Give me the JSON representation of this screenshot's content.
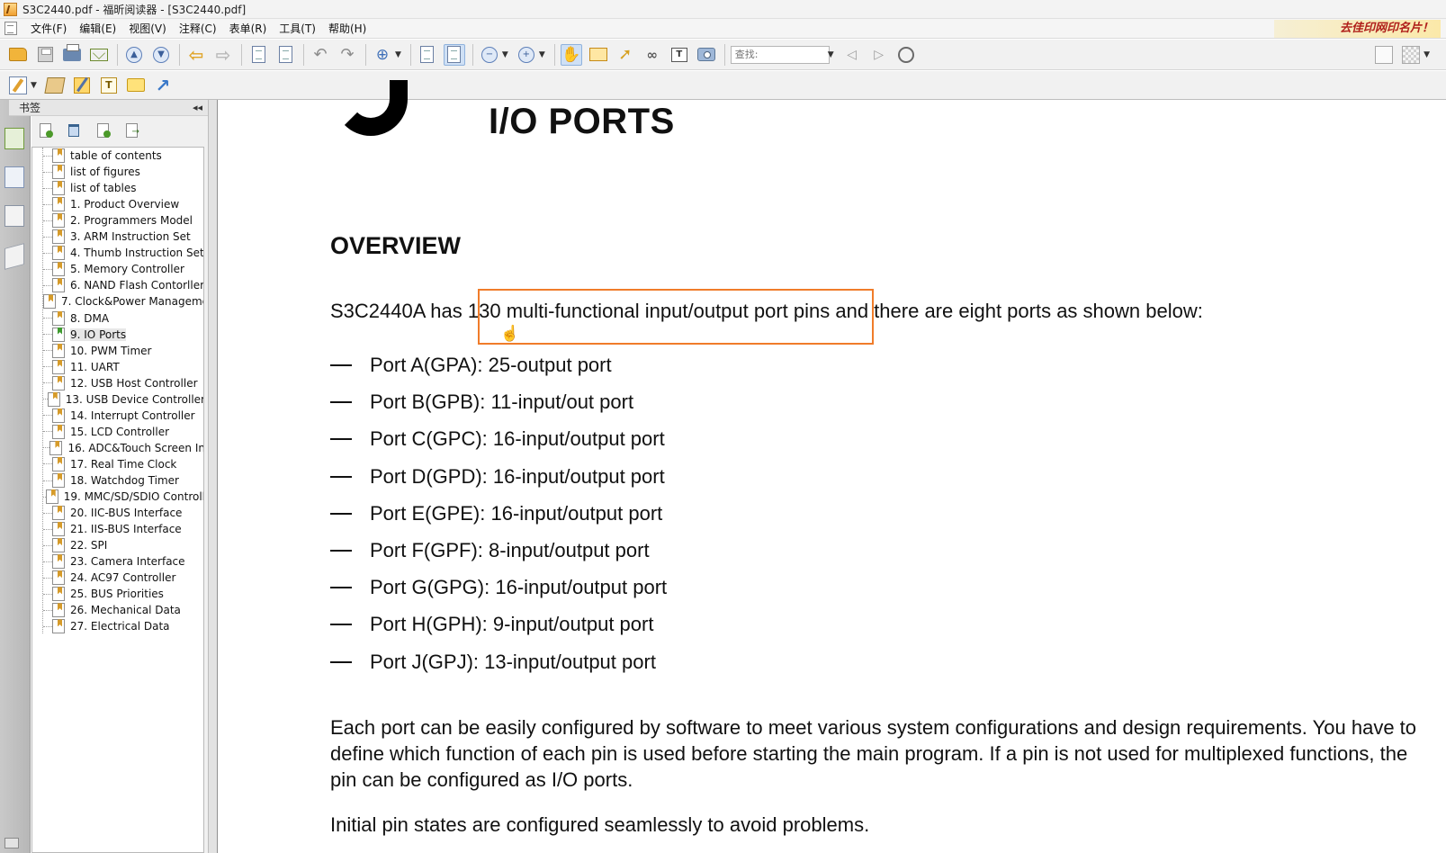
{
  "window": {
    "title": "S3C2440.pdf - 福昕阅读器 - [S3C2440.pdf]"
  },
  "menu": {
    "items": [
      "文件(F)",
      "编辑(E)",
      "视图(V)",
      "注释(C)",
      "表单(R)",
      "工具(T)",
      "帮助(H)"
    ],
    "ad_text": "去佳印网印名片！"
  },
  "toolbar": {
    "search_placeholder": "查找:"
  },
  "sidebar": {
    "title": "书签",
    "collapse_glyph": "◂◂",
    "bookmarks": [
      "table of contents",
      "list of figures",
      "list of tables",
      "1. Product Overview",
      "2. Programmers Model",
      "3. ARM Instruction Set",
      "4. Thumb Instruction Set",
      "5. Memory Controller",
      "6. NAND Flash Contorller",
      "7. Clock&Power Manageme",
      "8. DMA",
      "9. IO Ports",
      "10. PWM Timer",
      "11. UART",
      "12. USB Host Controller",
      "13. USB Device Controller",
      "14. Interrupt Controller",
      "15. LCD Controller",
      "16. ADC&Touch Screen In",
      "17. Real Time Clock",
      "18. Watchdog Timer",
      "19. MMC/SD/SDIO Controll",
      "20. IIC-BUS Interface",
      "21. IIS-BUS Interface",
      "22. SPI",
      "23. Camera Interface",
      "24. AC97 Controller",
      "25. BUS Priorities",
      "26. Mechanical Data",
      "27. Electrical Data"
    ],
    "selected_index": 11
  },
  "document": {
    "chapter_title": "I/O PORTS",
    "section_heading": "OVERVIEW",
    "intro": "S3C2440A has 130 multi-functional input/output port pins and there are eight ports as shown below:",
    "ports": [
      "Port A(GPA): 25-output port",
      "Port B(GPB): 11-input/out port",
      "Port C(GPC): 16-input/output port",
      "Port D(GPD): 16-input/output port",
      "Port E(GPE): 16-input/output port",
      "Port F(GPF): 8-input/output port",
      "Port G(GPG): 16-input/output port",
      "Port H(GPH): 9-input/output port",
      "Port J(GPJ): 13-input/output port"
    ],
    "paragraph": "Each port can be easily configured by software to meet various system configurations and design requirements. You have to define which function of each pin is used before starting the main program. If a pin is not used for multiplexed functions, the pin can be configured as I/O ports.",
    "paragraph2": "Initial pin states are configured seamlessly to avoid problems."
  },
  "colors": {
    "highlight_box": "#f07c2a",
    "ad_text": "#b0201b"
  }
}
